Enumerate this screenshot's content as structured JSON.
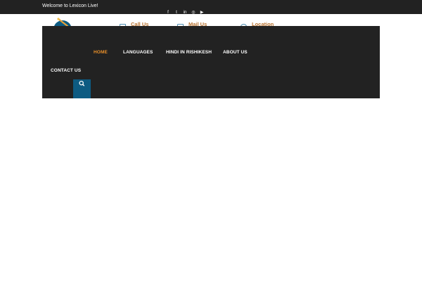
{
  "topbar": {
    "welcome": "Welcome to Lexicon Live!",
    "socials": [
      {
        "name": "facebook-icon",
        "glyph": "f"
      },
      {
        "name": "twitter-icon",
        "glyph": "t"
      },
      {
        "name": "linkedin-icon",
        "glyph": "in"
      },
      {
        "name": "instagram-icon",
        "glyph": "◎"
      },
      {
        "name": "youtube-icon",
        "glyph": "▶"
      }
    ]
  },
  "header": {
    "call_label": "Call Us",
    "mail_label": "Mail Us",
    "location_label": "Location"
  },
  "nav": {
    "items": [
      {
        "label": "HOME",
        "active": true
      },
      {
        "label": "LANGUAGES",
        "active": false
      },
      {
        "label": "HINDI IN RISHIKESH",
        "active": false
      },
      {
        "label": "ABOUT US",
        "active": false
      },
      {
        "label": "CONTACT US",
        "active": false
      }
    ]
  },
  "colors": {
    "topbar_bg": "#222222",
    "menu_bg": "#222222",
    "accent_orange": "#e88f2a",
    "header_label": "#b8722f",
    "search_button": "#0d5b82"
  },
  "icons": {
    "search": "search-icon",
    "logo": "logo"
  }
}
